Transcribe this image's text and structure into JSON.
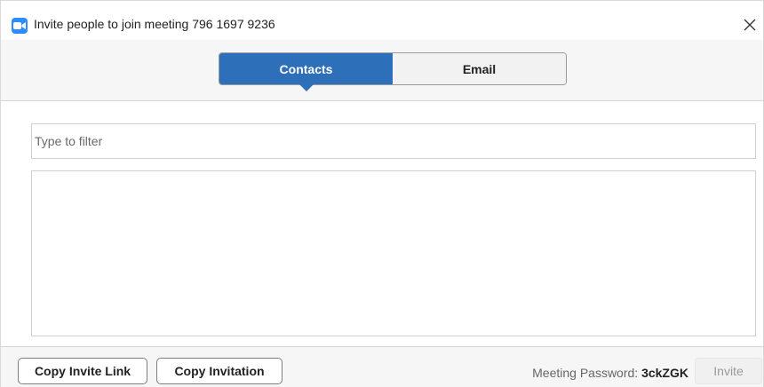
{
  "window": {
    "title": "Invite people to join meeting 796 1697 9236",
    "app_icon": "zoom-camera-icon",
    "close_icon": "close-icon"
  },
  "tabs": [
    {
      "label": "Contacts",
      "active": true
    },
    {
      "label": "Email",
      "active": false
    }
  ],
  "filter": {
    "placeholder": "Type to filter",
    "value": ""
  },
  "footer": {
    "copy_link_label": "Copy Invite Link",
    "copy_invitation_label": "Copy Invitation",
    "password_label": "Meeting Password:",
    "password_value": "3ckZGK",
    "invite_label": "Invite",
    "invite_enabled": false
  },
  "colors": {
    "accent": "#2e6fba",
    "app_icon": "#2d8cff",
    "band_bg": "#f6f6f6",
    "disabled_text": "#9a9a9a"
  }
}
